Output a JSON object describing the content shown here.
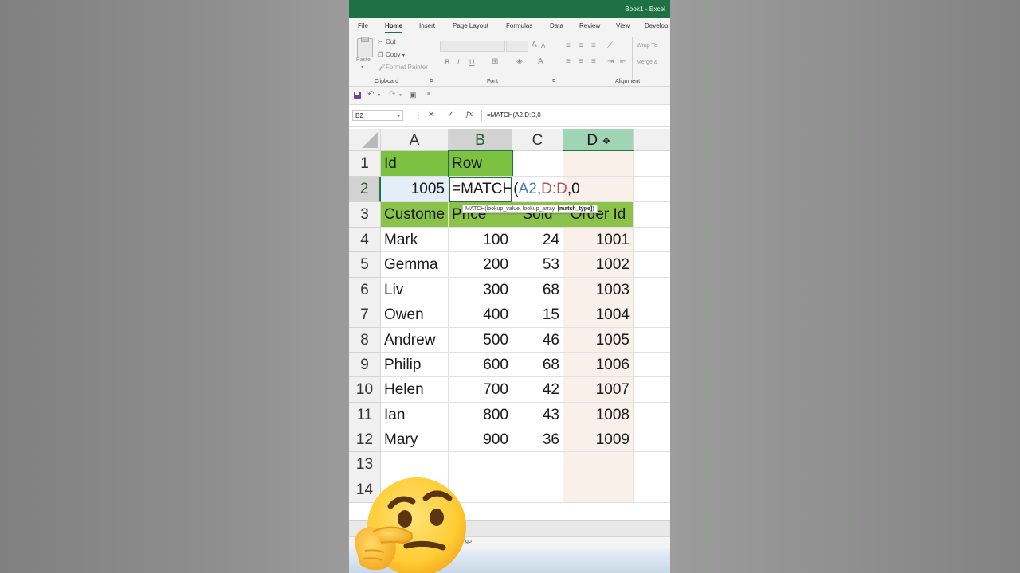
{
  "window": {
    "title": "Book1 - Excel"
  },
  "tabs": [
    "File",
    "Home",
    "Insert",
    "Page Layout",
    "Formulas",
    "Data",
    "Review",
    "View",
    "Develop"
  ],
  "active_tab": "Home",
  "ribbon": {
    "clipboard": {
      "paste": "Paste",
      "cut": "Cut",
      "copy": "Copy",
      "format_painter": "Format Painter",
      "label": "Clipboard"
    },
    "font": {
      "bold": "B",
      "italic": "I",
      "underline": "U",
      "label": "Font",
      "grow": "A",
      "shrink": "A"
    },
    "alignment": {
      "wrap": "Wrap Te",
      "merge": "Merge &",
      "label": "Alignment"
    }
  },
  "formula_bar": {
    "name_box": "B2",
    "cancel": "✕",
    "enter": "✓",
    "fx": "fx",
    "formula": "=MATCH(A2,D:D,0"
  },
  "columns": [
    "A",
    "B",
    "C",
    "D"
  ],
  "rows": [
    "1",
    "2",
    "3",
    "4",
    "5",
    "6",
    "7",
    "8",
    "9",
    "10",
    "11",
    "12",
    "13",
    "14"
  ],
  "cells": {
    "A1": "Id",
    "B1": "Row",
    "A2": "1005",
    "B2_parts": {
      "prefix": "=MATCH(",
      "ref1": "A2",
      "comma1": ",",
      "ref2": "D:D",
      "suffix": ",0"
    },
    "A3": "Custome",
    "B3": "Price",
    "C3": "Sold",
    "D3": "Order Id"
  },
  "table": [
    {
      "name": "Mark",
      "price": "100",
      "sold": "24",
      "order_id": "1001"
    },
    {
      "name": "Gemma",
      "price": "200",
      "sold": "53",
      "order_id": "1002"
    },
    {
      "name": "Liv",
      "price": "300",
      "sold": "68",
      "order_id": "1003"
    },
    {
      "name": "Owen",
      "price": "400",
      "sold": "15",
      "order_id": "1004"
    },
    {
      "name": "Andrew",
      "price": "500",
      "sold": "46",
      "order_id": "1005"
    },
    {
      "name": "Philip",
      "price": "600",
      "sold": "68",
      "order_id": "1006"
    },
    {
      "name": "Helen",
      "price": "700",
      "sold": "42",
      "order_id": "1007"
    },
    {
      "name": "Ian",
      "price": "800",
      "sold": "43",
      "order_id": "1008"
    },
    {
      "name": "Mary",
      "price": "900",
      "sold": "36",
      "order_id": "1009"
    }
  ],
  "tooltip": {
    "text": "MATCH(lookup_value, lookup_array, ",
    "bold": "[match_type]",
    "close": ")"
  },
  "status": {
    "text": "go"
  },
  "colors": {
    "excel_green": "#217346",
    "header_fill": "#8bc34a",
    "ref_blue": "#3c7cc4",
    "ref_red": "#c0504d"
  },
  "icons": [
    "paste-icon",
    "cut-icon",
    "copy-icon",
    "format-painter-icon",
    "save-icon",
    "undo-icon",
    "redo-icon",
    "thinking-face-emoji",
    "move-cursor-icon"
  ]
}
